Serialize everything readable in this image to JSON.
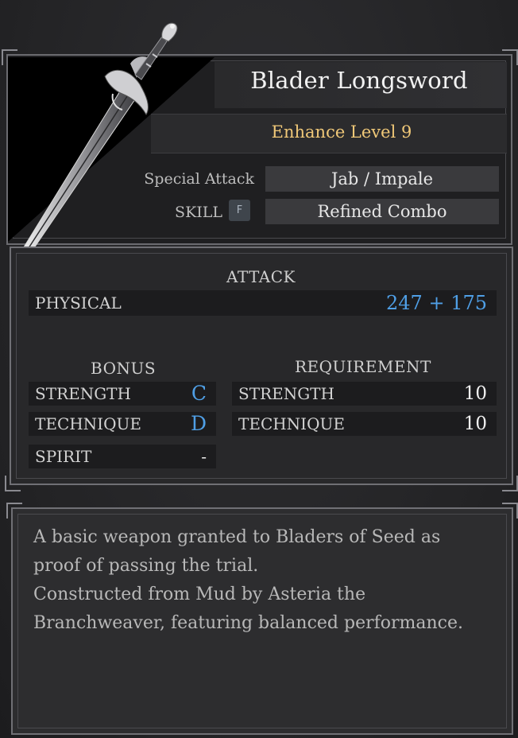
{
  "item": {
    "name": "Blader Longsword",
    "enhance_level": "Enhance Level 9",
    "special_attack_label": "Special Attack",
    "special_attack_value": "Jab / Impale",
    "skill_label": "SKILL",
    "skill_key": "F",
    "skill_value": "Refined Combo",
    "icon": "sword-icon"
  },
  "attack": {
    "title": "ATTACK",
    "physical_label": "PHYSICAL",
    "physical_value": "247 + 175"
  },
  "bonus": {
    "title": "BONUS",
    "rows": [
      {
        "label": "STRENGTH",
        "grade": "C"
      },
      {
        "label": "TECHNIQUE",
        "grade": "D"
      },
      {
        "label": "SPIRIT",
        "grade": "-"
      }
    ]
  },
  "requirement": {
    "title": "REQUIREMENT",
    "rows": [
      {
        "label": "STRENGTH",
        "value": "10"
      },
      {
        "label": "TECHNIQUE",
        "value": "10"
      }
    ]
  },
  "description": {
    "lines": [
      "A basic weapon granted to Bladers of Seed as",
      "proof of passing the trial.",
      "Constructed from Mud by Asteria the",
      "Branchweaver, featuring balanced performance."
    ]
  },
  "colors": {
    "accent_gold": "#f0c878",
    "stat_blue": "#4f9fe6",
    "panel_border": "#707075"
  }
}
